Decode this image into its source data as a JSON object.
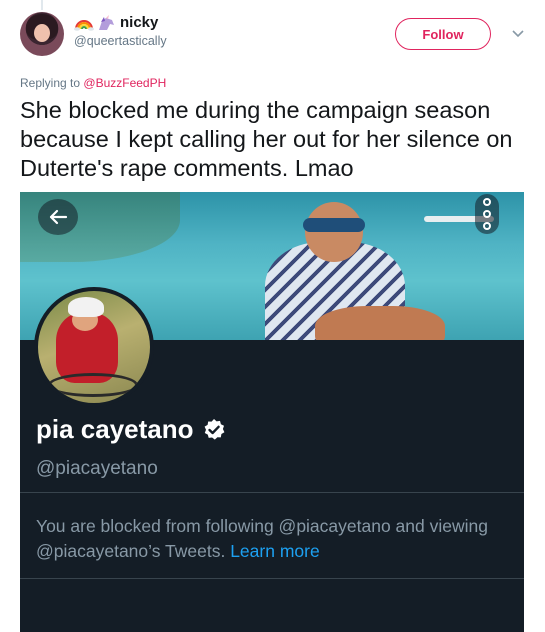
{
  "tweet": {
    "author": {
      "display_name": "nicky",
      "handle": "@queertastically",
      "emoji_icons": [
        "rainbow-icon",
        "unicorn-icon"
      ]
    },
    "follow_label": "Follow",
    "replying_prefix": "Replying to",
    "replying_mention": "@BuzzFeedPH",
    "text": "She blocked me during the campaign season because I kept calling her out for her silence on Duterte's rape comments. Lmao"
  },
  "screenshot": {
    "profile": {
      "name": "pia cayetano",
      "handle": "@piacayetano",
      "verified": true
    },
    "blocked_message": "You are blocked from following @piacayetano and viewing @piacayetano’s Tweets.",
    "learn_more": "Learn more"
  },
  "colors": {
    "accent": "#e0245e",
    "link_blue": "#1da1f2",
    "dark_bg": "#141d26",
    "muted": "#8899a6"
  }
}
